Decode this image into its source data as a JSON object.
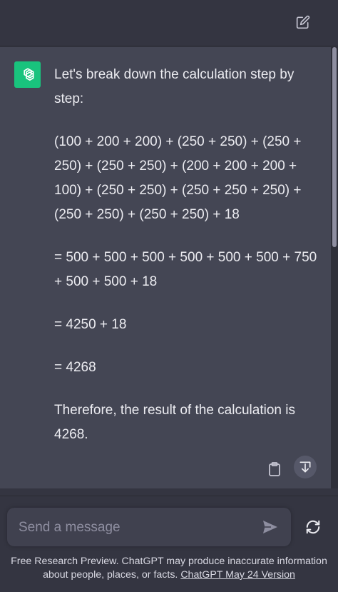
{
  "topbar": {
    "new_chat_icon": "edit-square-icon"
  },
  "message": {
    "avatar_icon": "openai-logo-icon",
    "paragraphs": [
      "Let's break down the calculation step by step:",
      "(100 + 200 + 200) + (250 + 250) + (250 + 250) + (250 + 250) + (200 + 200 + 200 + 100) + (250 + 250) + (250 + 250 + 250) + (250 + 250) + (250 + 250) + 18",
      "= 500 + 500 + 500 + 500 + 500 + 500 + 750 + 500 + 500 + 18",
      "= 4250 + 18",
      "= 4268",
      "Therefore, the result of the calculation is 4268."
    ],
    "copy_icon": "clipboard-icon",
    "scroll_icon": "arrow-down-icon"
  },
  "composer": {
    "placeholder": "Send a message",
    "value": "",
    "send_icon": "paper-plane-icon",
    "regenerate_icon": "refresh-icon"
  },
  "footer": {
    "text": "Free Research Preview. ChatGPT may produce inaccurate information about people, places, or facts.",
    "link": "ChatGPT May 24 Version"
  },
  "colors": {
    "background": "#343541",
    "message_background": "#444654",
    "avatar": "#19C37D",
    "input": "#40414F",
    "text": "#ECECF1"
  }
}
